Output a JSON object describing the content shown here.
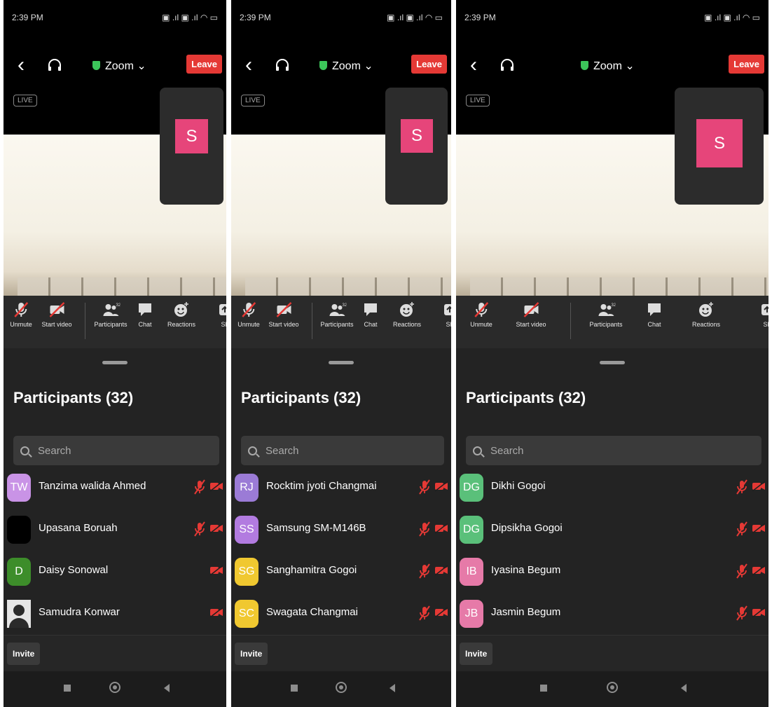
{
  "colors": {
    "leave": "#e53935",
    "self_avatar": "#e6457a",
    "muted_red": "#e53935",
    "shield_green": "#3cc65a"
  },
  "panels": [
    {
      "status_time": "2:39 PM",
      "status_icons": "▣ .ıl ▣ .ıl ◠ ▭",
      "meeting_title": "Zoom ⌄",
      "leave_label": "Leave",
      "live_label": "LIVE",
      "self_initial": "S",
      "toolbar": [
        {
          "label": "Unmute",
          "icon": "mic-muted-icon"
        },
        {
          "label": "Start video",
          "icon": "video-off-icon"
        },
        {
          "label": "Participants",
          "icon": "participants-icon",
          "badge": "32"
        },
        {
          "label": "Chat",
          "icon": "chat-icon"
        },
        {
          "label": "Reactions",
          "icon": "reactions-icon"
        },
        {
          "label": "Sh",
          "icon": "share-icon"
        }
      ],
      "participants_title": "Participants (32)",
      "search_placeholder": "Search",
      "participants": [
        {
          "initials": "TW",
          "name": "Tanzima walida Ahmed",
          "color": "#c993e6",
          "mic_muted": true,
          "video_off": true
        },
        {
          "initials": "",
          "name": "Upasana Boruah",
          "color": "#000000",
          "mic_muted": true,
          "video_off": true
        },
        {
          "initials": "D",
          "name": "Daisy Sonowal",
          "color": "#3d8d2a",
          "mic_muted": false,
          "video_off": true
        },
        {
          "initials": "",
          "name": "Samudra Konwar",
          "color": "#dddddd",
          "photo": true,
          "mic_muted": false,
          "video_off": true
        }
      ],
      "invite_label": "Invite"
    },
    {
      "status_time": "2:39 PM",
      "status_icons": "▣ .ıl ▣ .ıl ◠ ▭",
      "meeting_title": "Zoom ⌄",
      "leave_label": "Leave",
      "live_label": "LIVE",
      "self_initial": "S",
      "toolbar": [
        {
          "label": "Unmute",
          "icon": "mic-muted-icon"
        },
        {
          "label": "Start video",
          "icon": "video-off-icon"
        },
        {
          "label": "Participants",
          "icon": "participants-icon",
          "badge": "32"
        },
        {
          "label": "Chat",
          "icon": "chat-icon"
        },
        {
          "label": "Reactions",
          "icon": "reactions-icon"
        },
        {
          "label": "Sh",
          "icon": "share-icon"
        }
      ],
      "participants_title": "Participants (32)",
      "search_placeholder": "Search",
      "participants": [
        {
          "initials": "RJ",
          "name": "Rocktim jyoti Changmai",
          "color": "#9b7bd6",
          "mic_muted": true,
          "video_off": true
        },
        {
          "initials": "SS",
          "name": "Samsung SM-M146B",
          "color": "#b27be0",
          "mic_muted": true,
          "video_off": true
        },
        {
          "initials": "SG",
          "name": "Sanghamitra Gogoi",
          "color": "#f0c830",
          "mic_muted": true,
          "video_off": true
        },
        {
          "initials": "SC",
          "name": "Swagata Changmai",
          "color": "#f0c830",
          "mic_muted": true,
          "video_off": true
        }
      ],
      "invite_label": "Invite"
    },
    {
      "status_time": "2:39 PM",
      "status_icons": "▣ .ıl ▣ .ıl ◠ ▭",
      "meeting_title": "Zoom ⌄",
      "leave_label": "Leave",
      "live_label": "LIVE",
      "self_initial": "S",
      "toolbar": [
        {
          "label": "Unmute",
          "icon": "mic-muted-icon"
        },
        {
          "label": "Start video",
          "icon": "video-off-icon"
        },
        {
          "label": "Participants",
          "icon": "participants-icon",
          "badge": "32"
        },
        {
          "label": "Chat",
          "icon": "chat-icon"
        },
        {
          "label": "Reactions",
          "icon": "reactions-icon"
        },
        {
          "label": "Sh",
          "icon": "share-icon"
        }
      ],
      "participants_title": "Participants (32)",
      "search_placeholder": "Search",
      "participants": [
        {
          "initials": "DG",
          "name": "Dikhi Gogoi",
          "color": "#5ac07a",
          "mic_muted": true,
          "video_off": true
        },
        {
          "initials": "DG",
          "name": "Dipsikha Gogoi",
          "color": "#5ac07a",
          "mic_muted": true,
          "video_off": true
        },
        {
          "initials": "IB",
          "name": "Iyasina Begum",
          "color": "#e67aa8",
          "mic_muted": true,
          "video_off": true
        },
        {
          "initials": "JB",
          "name": "Jasmin Begum",
          "color": "#e67aa8",
          "mic_muted": true,
          "video_off": true
        }
      ],
      "invite_label": "Invite"
    }
  ]
}
